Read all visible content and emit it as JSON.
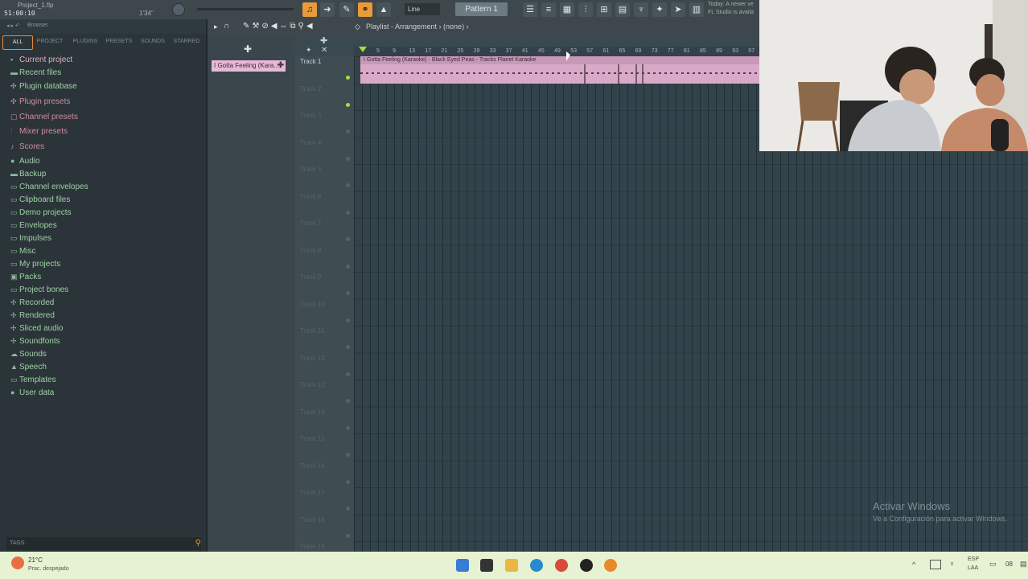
{
  "titlebar": {
    "project": "Project_1.flp",
    "time": "51:00:10",
    "bars": "1'34\"",
    "snap": "Line",
    "pattern": "Pattern 1",
    "hint_line1": "Today: A newer ve",
    "hint_line2": "FL Studio is availa"
  },
  "browser": {
    "header": "Browser",
    "tabs": [
      "ALL",
      "PROJECT",
      "PLUGINS",
      "PRESETS",
      "SOUNDS",
      "STARRED"
    ],
    "items": [
      {
        "label": "Current project",
        "icon": "project-icon"
      },
      {
        "label": "Recent files",
        "icon": "folder-icon"
      },
      {
        "label": "Plugin database",
        "icon": "plugin-icon"
      },
      {
        "label": "Plugin presets",
        "icon": "plugin-icon"
      },
      {
        "label": "Channel presets",
        "icon": "channel-icon"
      },
      {
        "label": "Mixer presets",
        "icon": "mixer-icon"
      },
      {
        "label": "Scores",
        "icon": "note-icon"
      },
      {
        "label": "Audio",
        "icon": "user-icon"
      },
      {
        "label": "Backup",
        "icon": "folder-icon"
      },
      {
        "label": "Channel envelopes",
        "icon": "folder-icon"
      },
      {
        "label": "Clipboard files",
        "icon": "folder-icon"
      },
      {
        "label": "Demo projects",
        "icon": "folder-icon"
      },
      {
        "label": "Envelopes",
        "icon": "folder-icon"
      },
      {
        "label": "Impulses",
        "icon": "folder-icon"
      },
      {
        "label": "Misc",
        "icon": "folder-icon"
      },
      {
        "label": "My projects",
        "icon": "folder-icon"
      },
      {
        "label": "Packs",
        "icon": "packs-icon"
      },
      {
        "label": "Project bones",
        "icon": "folder-icon"
      },
      {
        "label": "Recorded",
        "icon": "recorded-icon"
      },
      {
        "label": "Rendered",
        "icon": "rendered-icon"
      },
      {
        "label": "Sliced audio",
        "icon": "sliced-icon"
      },
      {
        "label": "Soundfonts",
        "icon": "soundfont-icon"
      },
      {
        "label": "Sounds",
        "icon": "cloud-icon"
      },
      {
        "label": "Speech",
        "icon": "speech-icon"
      },
      {
        "label": "Templates",
        "icon": "folder-icon"
      },
      {
        "label": "User data",
        "icon": "user-icon"
      }
    ],
    "tags_label": "TAGS"
  },
  "channel_clip": "I Gotta Feeling (Kara...",
  "playlist": {
    "title": "Playlist - Arrangement",
    "arrangement": "(none)",
    "ruler": [
      "5",
      "9",
      "13",
      "17",
      "21",
      "25",
      "29",
      "33",
      "37",
      "41",
      "45",
      "49",
      "53",
      "57",
      "61",
      "65",
      "69",
      "73",
      "77",
      "81",
      "85",
      "89",
      "93",
      "97"
    ],
    "tracks": [
      "Track 1",
      "Track 2",
      "Track 3",
      "Track 4",
      "Track 5",
      "Track 6",
      "Track 7",
      "Track 8",
      "Track 9",
      "Track 10",
      "Track 11",
      "Track 12",
      "Track 13",
      "Track 14",
      "Track 15",
      "Track 16",
      "Track 17",
      "Track 18",
      "Track 19"
    ],
    "clip_label": "I Gotta Feeling (Karaoke) - Black Eyed Peas - Tracks Planet Karaoke"
  },
  "watermark": {
    "line1": "Activar Windows",
    "line2": "Ve a Configuración para activar Windows."
  },
  "taskbar": {
    "weather_temp": "21°C",
    "weather_desc": "Prac. despejado",
    "lang1": "ESP",
    "lang2": "LAA",
    "clock": "08"
  },
  "colors": {
    "accent": "#e89a3c",
    "clip": "#d9aac8",
    "browser_text": "#9fd0a6"
  }
}
